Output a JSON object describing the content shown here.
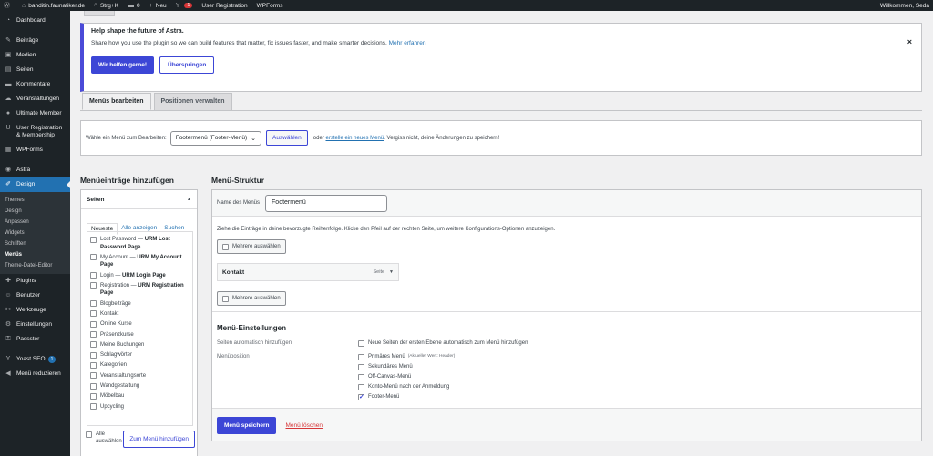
{
  "adminbar": {
    "site": "banditin.faunatiker.de",
    "shortcut": "Strg+K",
    "comments": "0",
    "new": "Neu",
    "yoast_count": "1",
    "user_reg": "User Registration",
    "wpforms": "WPForms",
    "greeting": "Willkommen, Seda"
  },
  "sidebar": {
    "items_top": [
      {
        "icon": "⌂",
        "label": "Dashboard"
      }
    ],
    "items_main": [
      {
        "icon": "✎",
        "label": "Beiträge"
      },
      {
        "icon": "▣",
        "label": "Medien"
      },
      {
        "icon": "▤",
        "label": "Seiten"
      },
      {
        "icon": "✉",
        "label": "Kommentare"
      },
      {
        "icon": "☁",
        "label": "Veranstaltungen"
      },
      {
        "icon": "●",
        "label": "Ultimate Member"
      },
      {
        "icon": "U",
        "label": "User Registration & Membership"
      },
      {
        "icon": "▦",
        "label": "WPForms"
      }
    ],
    "astra": "Astra",
    "design": "Design",
    "design_sub": [
      "Themes",
      "Design",
      "Anpassen",
      "Widgets",
      "Schriften",
      "Menüs",
      "Theme-Datei-Editor"
    ],
    "items_bottom": [
      {
        "icon": "✚",
        "label": "Plugins"
      },
      {
        "icon": "☺",
        "label": "Benutzer"
      },
      {
        "icon": "✂",
        "label": "Werkzeuge"
      },
      {
        "icon": "⚙",
        "label": "Einstellungen"
      },
      {
        "icon": "⚿",
        "label": "Passster"
      }
    ],
    "yoast": "Yoast SEO",
    "yoast_badge": "1",
    "collapse": "Menü reduzieren"
  },
  "notice": {
    "title": "Help shape the future of Astra.",
    "text": "Share how you use the plugin so we can build features that matter, fix issues faster, and make smarter decisions.",
    "link": "Mehr erfahren",
    "btn_yes": "Wir helfen gerne!",
    "btn_skip": "Überspringen",
    "close": "×"
  },
  "tabs": {
    "edit": "Menüs bearbeiten",
    "locations": "Positionen verwalten"
  },
  "manage": {
    "label": "Wähle ein Menü zum Bearbeiten:",
    "selected": "Footermenü (Footer-Menü)",
    "select_btn": "Auswählen",
    "or": "oder",
    "create_link": "erstelle ein neues Menü",
    "tail": ". Vergiss nicht, deine Änderungen zu speichern!"
  },
  "add_items": {
    "title": "Menüeinträge hinzufügen",
    "section": "Seiten",
    "tabs": [
      "Neueste",
      "Alle anzeigen",
      "Suchen"
    ],
    "pages": [
      {
        "label": "Lost Password",
        "tag": "URM Lost Password Page"
      },
      {
        "label": "My Account",
        "tag": "URM My Account Page"
      },
      {
        "label": "Login",
        "tag": "URM Login Page"
      },
      {
        "label": "Registration",
        "tag": "URM Registration Page"
      },
      {
        "label": "Blogbeiträge",
        "tag": ""
      },
      {
        "label": "Kontakt",
        "tag": ""
      },
      {
        "label": "Online Kurse",
        "tag": ""
      },
      {
        "label": "Präsenzkurse",
        "tag": ""
      },
      {
        "label": "Meine Buchungen",
        "tag": ""
      },
      {
        "label": "Schlagwörter",
        "tag": ""
      },
      {
        "label": "Kategorien",
        "tag": ""
      },
      {
        "label": "Veranstaltungsorte",
        "tag": ""
      },
      {
        "label": "Wandgestaltung",
        "tag": ""
      },
      {
        "label": "Möbelbau",
        "tag": ""
      },
      {
        "label": "Upcycling",
        "tag": ""
      }
    ],
    "select_all": "Alle auswählen",
    "add_btn": "Zum Menü hinzufügen"
  },
  "structure": {
    "title": "Menü-Struktur",
    "name_label": "Name des Menüs",
    "name_value": "Footermenü",
    "hint": "Ziehe die Einträge in deine bevorzugte Reihenfolge. Klicke den Pfeil auf der rechten Seite, um weitere Konfigurations-Optionen anzuzeigen.",
    "multi_select": "Mehrere auswählen",
    "entry_title": "Kontakt",
    "entry_type": "Seite",
    "settings_title": "Menü-Einstellungen",
    "auto_add_label": "Seiten automatisch hinzufügen",
    "auto_add_option": "Neue Seiten der ersten Ebene automatisch zum Menü hinzufügen",
    "position_label": "Menüposition",
    "positions": [
      {
        "label": "Primäres Menü",
        "note": "(Aktueller Wert: Header)",
        "checked": false
      },
      {
        "label": "Sekundäres Menü",
        "note": "",
        "checked": false
      },
      {
        "label": "Off-Canvas-Menü",
        "note": "",
        "checked": false
      },
      {
        "label": "Konto-Menü nach der Anmeldung",
        "note": "",
        "checked": false
      },
      {
        "label": "Footer-Menü",
        "note": "",
        "checked": true
      }
    ],
    "save_btn": "Menü speichern",
    "delete_link": "Menü löschen"
  }
}
